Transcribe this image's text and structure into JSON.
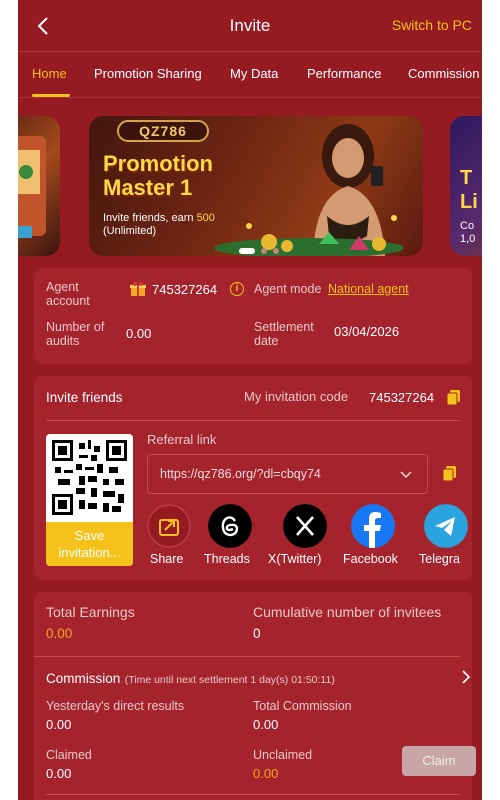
{
  "header": {
    "title": "Invite",
    "switch_label": "Switch to PC"
  },
  "tabs": [
    {
      "label": "Home",
      "active": true
    },
    {
      "label": "Promotion Sharing"
    },
    {
      "label": "My Data"
    },
    {
      "label": "Performance"
    },
    {
      "label": "Commission"
    }
  ],
  "banner": {
    "brand": "QZ786",
    "title_line1": "Promotion",
    "title_line2": "Master 1",
    "subtitle_line1": "Invite friends, earn",
    "subtitle_highlight": "500",
    "subtitle_line2": "(Unlimited)",
    "right_title_line1": "T",
    "right_title_line2": "Li",
    "right_sub_line1": "Co",
    "right_sub_line2": "1,0"
  },
  "agent": {
    "account_label": "Agent account",
    "account_value": "745327264",
    "mode_label": "Agent mode",
    "mode_value": "National agent",
    "audits_label": "Number of audits",
    "audits_value": "0.00",
    "settlement_label": "Settlement date",
    "settlement_value": "03/04/2026"
  },
  "invite": {
    "title": "Invite friends",
    "code_label": "My invitation code",
    "code_value": "745327264",
    "save_label": "Save invitation...",
    "referral_label": "Referral link",
    "referral_url": "https://qz786.org/?dl=cbqy74",
    "share": [
      {
        "label": "Share",
        "icon": "share-icon"
      },
      {
        "label": "Threads",
        "icon": "threads-icon"
      },
      {
        "label": "X(Twitter)",
        "icon": "x-twitter-icon"
      },
      {
        "label": "Facebook",
        "icon": "facebook-icon"
      },
      {
        "label": "Telegra",
        "icon": "telegram-icon"
      }
    ]
  },
  "earnings": {
    "total_label": "Total Earnings",
    "total_value": "0.00",
    "invitees_label": "Cumulative number of invitees",
    "invitees_value": "0"
  },
  "commission": {
    "title": "Commission",
    "timer": "(Time until next settlement  1 day(s) 01:50:11)",
    "yesterday_label": "Yesterday's direct results",
    "yesterday_value": "0.00",
    "total_label": "Total Commission",
    "total_value": "0.00",
    "claimed_label": "Claimed",
    "claimed_value": "0.00",
    "unclaimed_label": "Unclaimed",
    "unclaimed_value": "0.00",
    "claim_button": "Claim"
  },
  "colors": {
    "background": "#951a22",
    "panel": "#a5232c",
    "accent": "#f5c21b",
    "orange": "#f5a623"
  }
}
